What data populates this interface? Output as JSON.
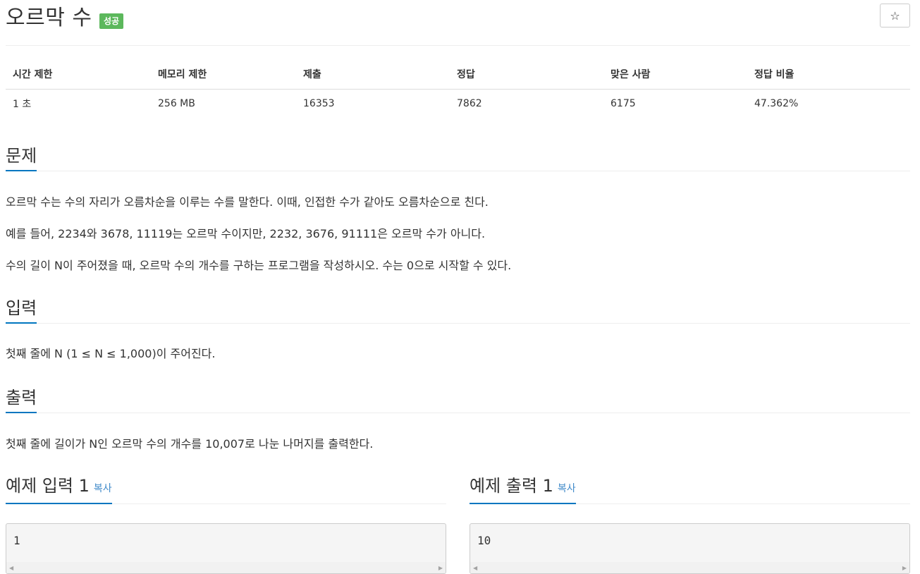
{
  "problem": {
    "title": "오르막 수",
    "badge": "성공",
    "star_icon": "star-icon"
  },
  "info_table": {
    "headers": [
      "시간 제한",
      "메모리 제한",
      "제출",
      "정답",
      "맞은 사람",
      "정답 비율"
    ],
    "values": [
      "1 초",
      "256 MB",
      "16353",
      "7862",
      "6175",
      "47.362%"
    ]
  },
  "description": {
    "title": "문제",
    "paragraphs": [
      "오르막 수는 수의 자리가 오름차순을 이루는 수를 말한다. 이때, 인접한 수가 같아도 오름차순으로 친다.",
      "예를 들어, 2234와 3678, 11119는 오르막 수이지만, 2232, 3676, 91111은 오르막 수가 아니다.",
      "수의 길이 N이 주어졌을 때, 오르막 수의 개수를 구하는 프로그램을 작성하시오. 수는 0으로 시작할 수 있다."
    ]
  },
  "input": {
    "title": "입력",
    "text": "첫째 줄에 N (1 ≤ N ≤ 1,000)이 주어진다."
  },
  "output": {
    "title": "출력",
    "text": "첫째 줄에 길이가 N인 오르막 수의 개수를 10,007로 나눈 나머지를 출력한다."
  },
  "sample_input": {
    "title": "예제 입력 1",
    "copy_label": "복사",
    "value": "1"
  },
  "sample_output": {
    "title": "예제 출력 1",
    "copy_label": "복사",
    "value": "10"
  },
  "colors": {
    "accent": "#0076c0",
    "badge": "#5cb85c",
    "link": "#428bca"
  }
}
